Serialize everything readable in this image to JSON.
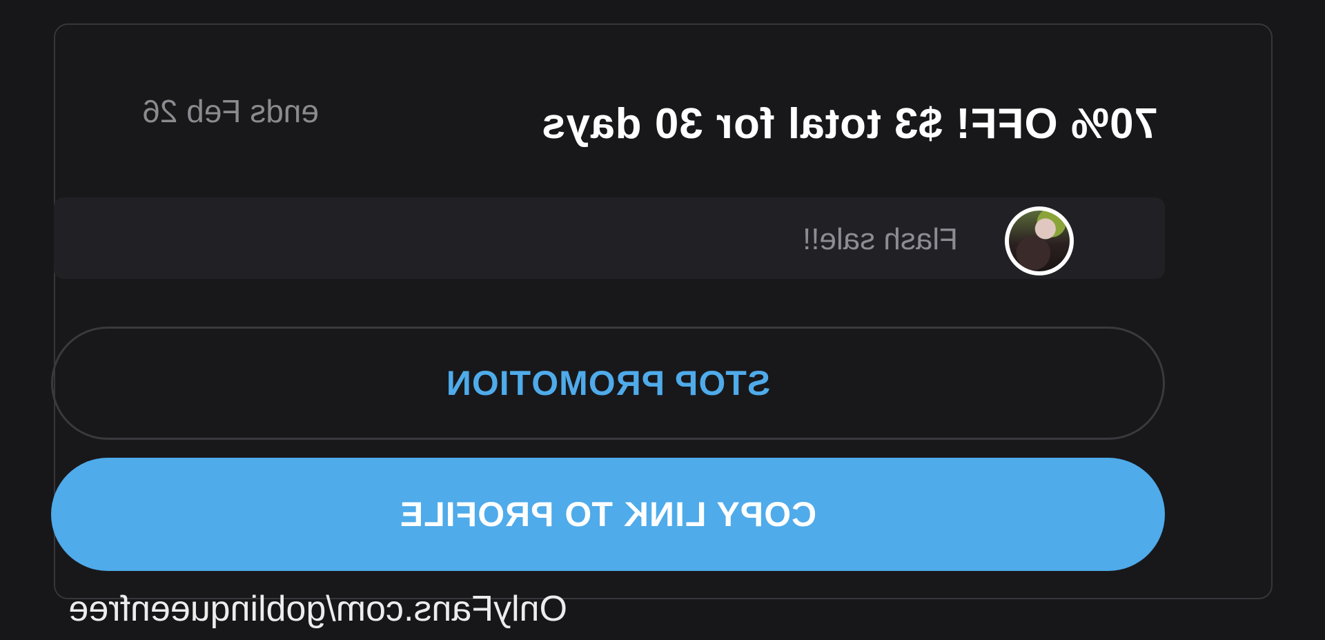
{
  "promotion": {
    "headline": "70% OFF! $3 total for 30 days",
    "expiry": "ends Feb 26",
    "message": "Flash sale!!"
  },
  "buttons": {
    "stop_label": "STOP PROMOTION",
    "copy_label": "COPY LINK TO PROFILE"
  },
  "watermark": "OnlyFans.com/goblinqueenfree",
  "colors": {
    "accent": "#4fabea",
    "background": "#17171a",
    "card_border": "#37373b",
    "muted_text": "#8c8c92"
  }
}
